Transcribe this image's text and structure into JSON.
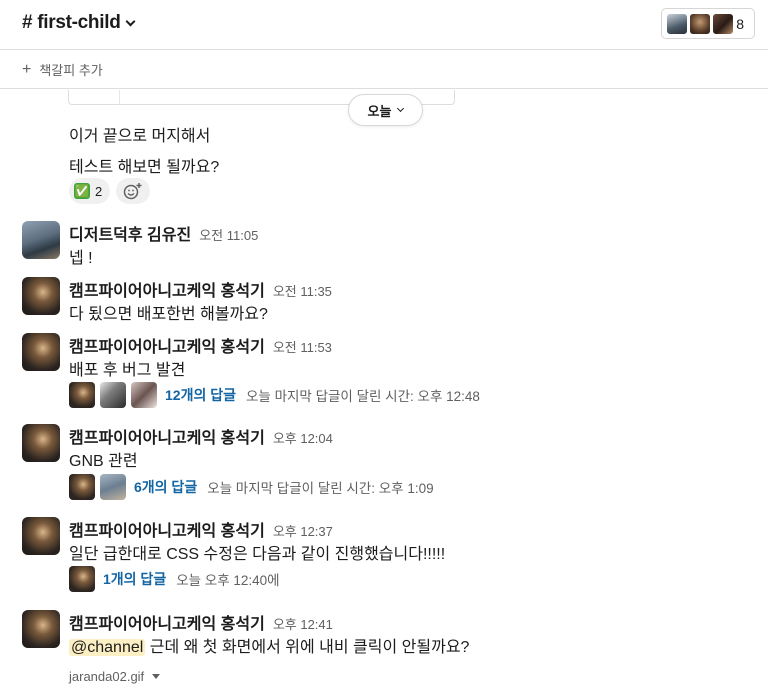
{
  "header": {
    "channel_name": "# first-child",
    "member_count": "8"
  },
  "bookmarks": {
    "add_label": "책갈피 추가"
  },
  "day_divider": {
    "label": "오늘"
  },
  "previous_message": {
    "lines": [
      "이거 끝으로 머지해서",
      "테스트 해보면 될까요?"
    ],
    "reaction": {
      "emoji": "✅",
      "count": "2"
    }
  },
  "messages": [
    {
      "author": "디저트덕후 김유진",
      "time": "오전 11:05",
      "text": "넵 !"
    },
    {
      "author": "캠프파이어아니고케익 홍석기",
      "time": "오전 11:35",
      "text": "다 됬으면 배포한번 해볼까요?"
    },
    {
      "author": "캠프파이어아니고케익 홍석기",
      "time": "오전 11:53",
      "text": "배포 후 버그 발견",
      "thread": {
        "count": "12개의 답글",
        "meta": "오늘 마지막 답글이 달린 시간: 오후 12:48"
      }
    },
    {
      "author": "캠프파이어아니고케익 홍석기",
      "time": "오후 12:04",
      "text": "GNB 관련",
      "thread": {
        "count": "6개의 답글",
        "meta": "오늘 마지막 답글이 달린 시간: 오후 1:09"
      }
    },
    {
      "author": "캠프파이어아니고케익 홍석기",
      "time": "오후 12:37",
      "text": "일단 급한대로 CSS 수정은 다음과 같이 진행했습니다!!!!!",
      "thread": {
        "count": "1개의 답글",
        "meta": "오늘 오후 12:40에"
      }
    },
    {
      "author": "캠프파이어아니고케익 홍석기",
      "time": "오후 12:41",
      "mention": "@channel",
      "text": " 근데 왜 첫 화면에서 위에 내비 클릭이 안될까요?",
      "file": "jaranda02.gif"
    }
  ]
}
